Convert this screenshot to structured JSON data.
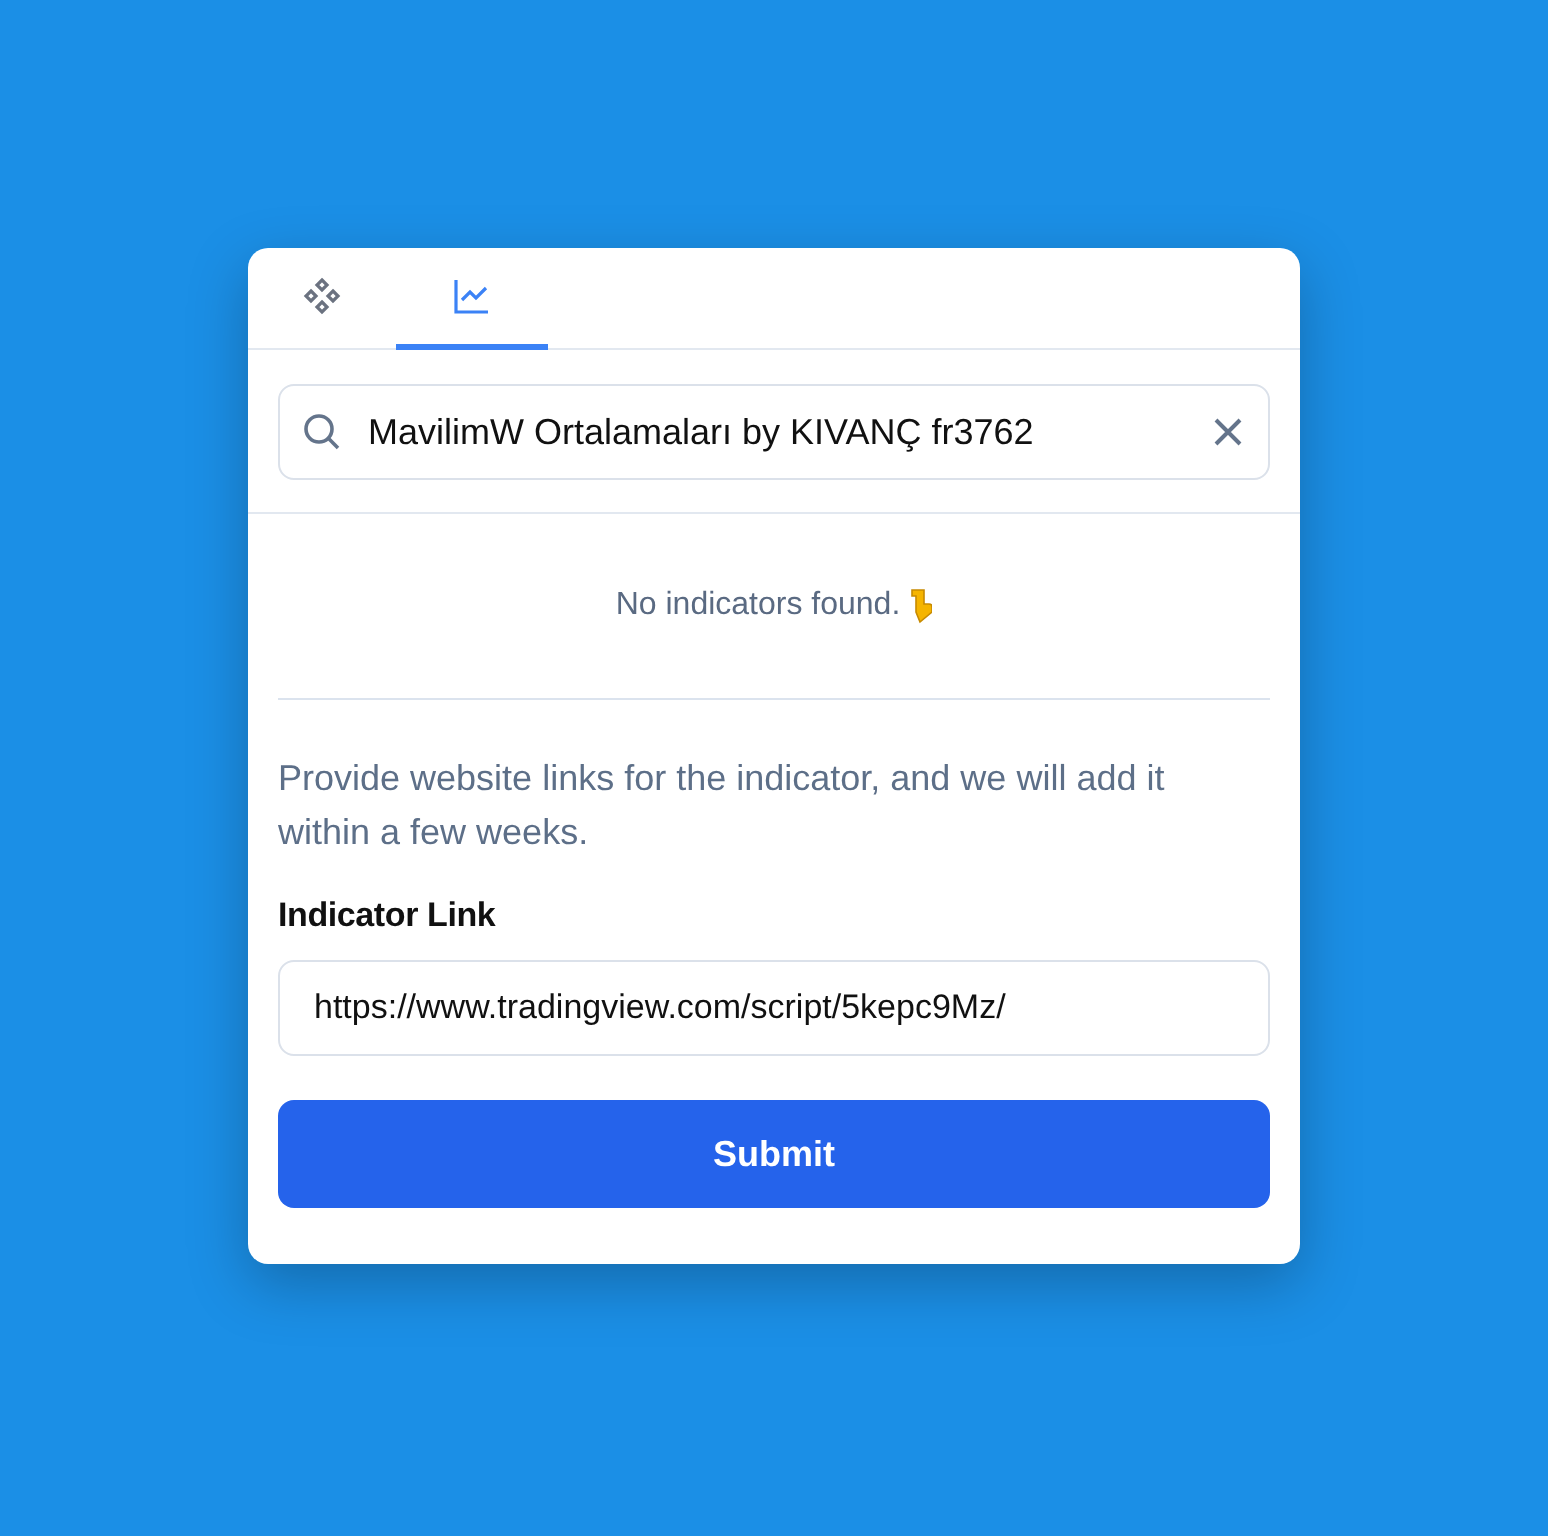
{
  "tabs": [
    {
      "kind": "components",
      "selected": false
    },
    {
      "kind": "chart",
      "selected": true
    }
  ],
  "search": {
    "value": "MavilimW Ortalamaları by KIVANÇ fr3762"
  },
  "empty_message": "No indicators found.",
  "hint": "Provide website links for the indicator, and we will add it within a few weeks.",
  "link_field": {
    "label": "Indicator Link",
    "value": "https://www.tradingview.com/script/5kepc9Mz/"
  },
  "submit_button": "Submit"
}
